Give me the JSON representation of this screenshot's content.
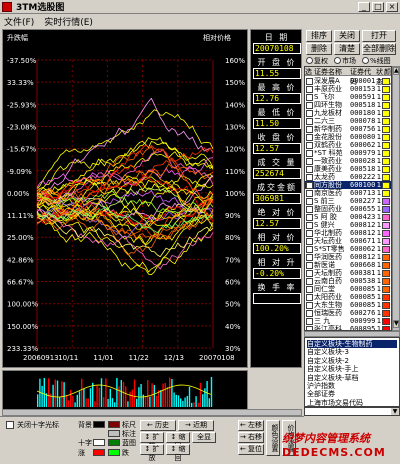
{
  "window": {
    "title": "3TM选股图",
    "menu": [
      "文件(F)",
      "实时行情(E)"
    ]
  },
  "chart": {
    "left_axis_title": "升跌幅",
    "right_axis_title": "相对价格",
    "left_ticks": [
      "-37.50%",
      "33.33%",
      "-25.93%",
      "-23.08%",
      "-15.67%",
      "-9.09%",
      "0.00%",
      "11.11%",
      "25.00%",
      "42.86%",
      "66.67%",
      "100.00%",
      "150.00%",
      "233.33%"
    ],
    "right_ticks": [
      "160%",
      "150%",
      "140%",
      "130%",
      "120%",
      "110%",
      "100%",
      "90%",
      "80%",
      "70%",
      "60%",
      "50%",
      "40%",
      "30%"
    ],
    "x_ticks": [
      "20060913",
      "10/11",
      "11/01",
      "11/22",
      "12/13",
      "20070108"
    ]
  },
  "info": {
    "items": [
      {
        "label": "日   期",
        "value": "20070108"
      },
      {
        "label": "开 盘 价",
        "value": "11.55"
      },
      {
        "label": "最 高 价",
        "value": "12.76"
      },
      {
        "label": "最 低 价",
        "value": "11.50"
      },
      {
        "label": "收 盘 价",
        "value": "12.57"
      },
      {
        "label": "成 交 量",
        "value": "252674"
      },
      {
        "label": "成交金额",
        "value": "306981"
      },
      {
        "label": "绝 对 价 格",
        "value": "12.57"
      },
      {
        "label": "相 对 价 格",
        "value": "100.20%"
      },
      {
        "label": "相 对 升 跌 幅",
        "value": "-0.20%"
      },
      {
        "label": "换 手 率",
        "value": ""
      }
    ]
  },
  "toolbar": {
    "row1": [
      "排序",
      "关闭",
      "打开"
    ],
    "row2": [
      "删除",
      "清楚",
      "全部删除"
    ],
    "radios": [
      "复权",
      "市场",
      "%线图"
    ]
  },
  "stock_list": {
    "headers": [
      "选",
      "证券名称",
      "证券代码",
      "状态",
      "颜色"
    ],
    "rows": [
      {
        "name": "深发展A",
        "code": "000001",
        "state": "1",
        "color": "#ffff00"
      },
      {
        "name": "丰原药业",
        "code": "000153",
        "state": "1",
        "color": "#ffff00"
      },
      {
        "name": "S 飞尔",
        "code": "000591",
        "state": "1",
        "color": "#ffff00"
      },
      {
        "name": "四环生物",
        "code": "000518",
        "state": "1",
        "color": "#ffff00"
      },
      {
        "name": "九龙板材",
        "code": "000180",
        "state": "1",
        "color": "#ffff00"
      },
      {
        "name": "二六三",
        "code": "000078",
        "state": "1",
        "color": "#ffff00"
      },
      {
        "name": "新华制药",
        "code": "000756",
        "state": "1",
        "color": "#ffff00"
      },
      {
        "name": "金花股份",
        "code": "600080",
        "state": "1",
        "color": "#ffff00"
      },
      {
        "name": "双鹤药业",
        "code": "600062",
        "state": "1",
        "color": "#ffff00"
      },
      {
        "name": "*ST 科苑",
        "code": "000979",
        "state": "1",
        "color": "#ffff00"
      },
      {
        "name": "一致药业",
        "code": "000028",
        "state": "1",
        "color": "#ffff00"
      },
      {
        "name": "康美药业",
        "code": "600518",
        "state": "1",
        "color": "#ffff00"
      },
      {
        "name": "太龙药",
        "code": "600222",
        "state": "1",
        "color": "#ffff00"
      },
      {
        "name": "同方股份",
        "code": "600100",
        "state": "1",
        "color": "#ffff00"
      },
      {
        "name": "南京医药",
        "code": "600713",
        "state": "1",
        "color": "#ffff00"
      },
      {
        "name": "S 前三",
        "code": "600227",
        "state": "1",
        "color": "#cc66ff"
      },
      {
        "name": "整固药业",
        "code": "600655",
        "state": "1",
        "color": "#9966ff"
      },
      {
        "name": "S 阿 胶",
        "code": "000423",
        "state": "1",
        "color": "#ff66cc"
      },
      {
        "name": "S 健兴",
        "code": "600812",
        "state": "1",
        "color": "#ff99ff"
      },
      {
        "name": "华北制药",
        "code": "600812",
        "state": "1",
        "color": "#ff66ff"
      },
      {
        "name": "天坛药业",
        "code": "600671",
        "state": "1",
        "color": "#ff99ff"
      },
      {
        "name": "S*ST零售",
        "code": "600062",
        "state": "1",
        "color": "#ff66cc"
      },
      {
        "name": "华润医药",
        "code": "600812",
        "state": "1",
        "color": "#ff6600"
      },
      {
        "name": "新医诺",
        "code": "600668",
        "state": "1",
        "color": "#ff6600"
      },
      {
        "name": "天坛制药",
        "code": "600381",
        "state": "1",
        "color": "#ff6600"
      },
      {
        "name": "云南白药",
        "code": "000538",
        "state": "1",
        "color": "#ff6600"
      },
      {
        "name": "同仁堂",
        "code": "600085",
        "state": "1",
        "color": "#ff6600"
      },
      {
        "name": "太阳药业",
        "code": "600085",
        "state": "1",
        "color": "#ff3300"
      },
      {
        "name": "大东生物",
        "code": "600085",
        "state": "1",
        "color": "#ff3300"
      },
      {
        "name": "恒瑞医药",
        "code": "600276",
        "state": "1",
        "color": "#ff3300"
      },
      {
        "name": "三 九",
        "code": "000999",
        "state": "1",
        "color": "#ff0000"
      },
      {
        "name": "张江高科",
        "code": "600895",
        "state": "1",
        "color": "#ff0000"
      }
    ]
  },
  "blocks": {
    "items": [
      "自定义板块-生物制药",
      "自定义板块-3",
      "自定义板块-2",
      "自定义板块-手上",
      "自定义板块-草档",
      "沪沪指数",
      "全部证券",
      "上海市场交易代码"
    ],
    "dropdown": ""
  },
  "legend": {
    "opt_label": "关闭十字光标",
    "rows": [
      {
        "label": "背景",
        "color": "#000000",
        "label2": "标尺",
        "color2": "#800000"
      },
      {
        "label": "",
        "color": "",
        "label2": "标注",
        "color2": "#c0c0c0"
      },
      {
        "label": "十字",
        "color": "#ffffff",
        "label2": "蓝图",
        "color2": "#008000"
      },
      {
        "label": "涨",
        "color": "#ff0000",
        "label2": "跌",
        "color2": "#00ff00"
      }
    ]
  },
  "nav": {
    "row1": [
      "← 历史",
      "→ 近期",
      "← 左移"
    ],
    "row2": [
      "↕ 扩放",
      "↕ 缩回",
      "全显",
      "→ 右移"
    ],
    "row3": [
      "↕ 扩放",
      "↕ 缩回",
      "← 复位"
    ],
    "side": [
      "颜色设置",
      "价格设置"
    ]
  },
  "watermark": {
    "line1": "织梦内容管理系统",
    "line2": "DEDECMS.COM"
  }
}
